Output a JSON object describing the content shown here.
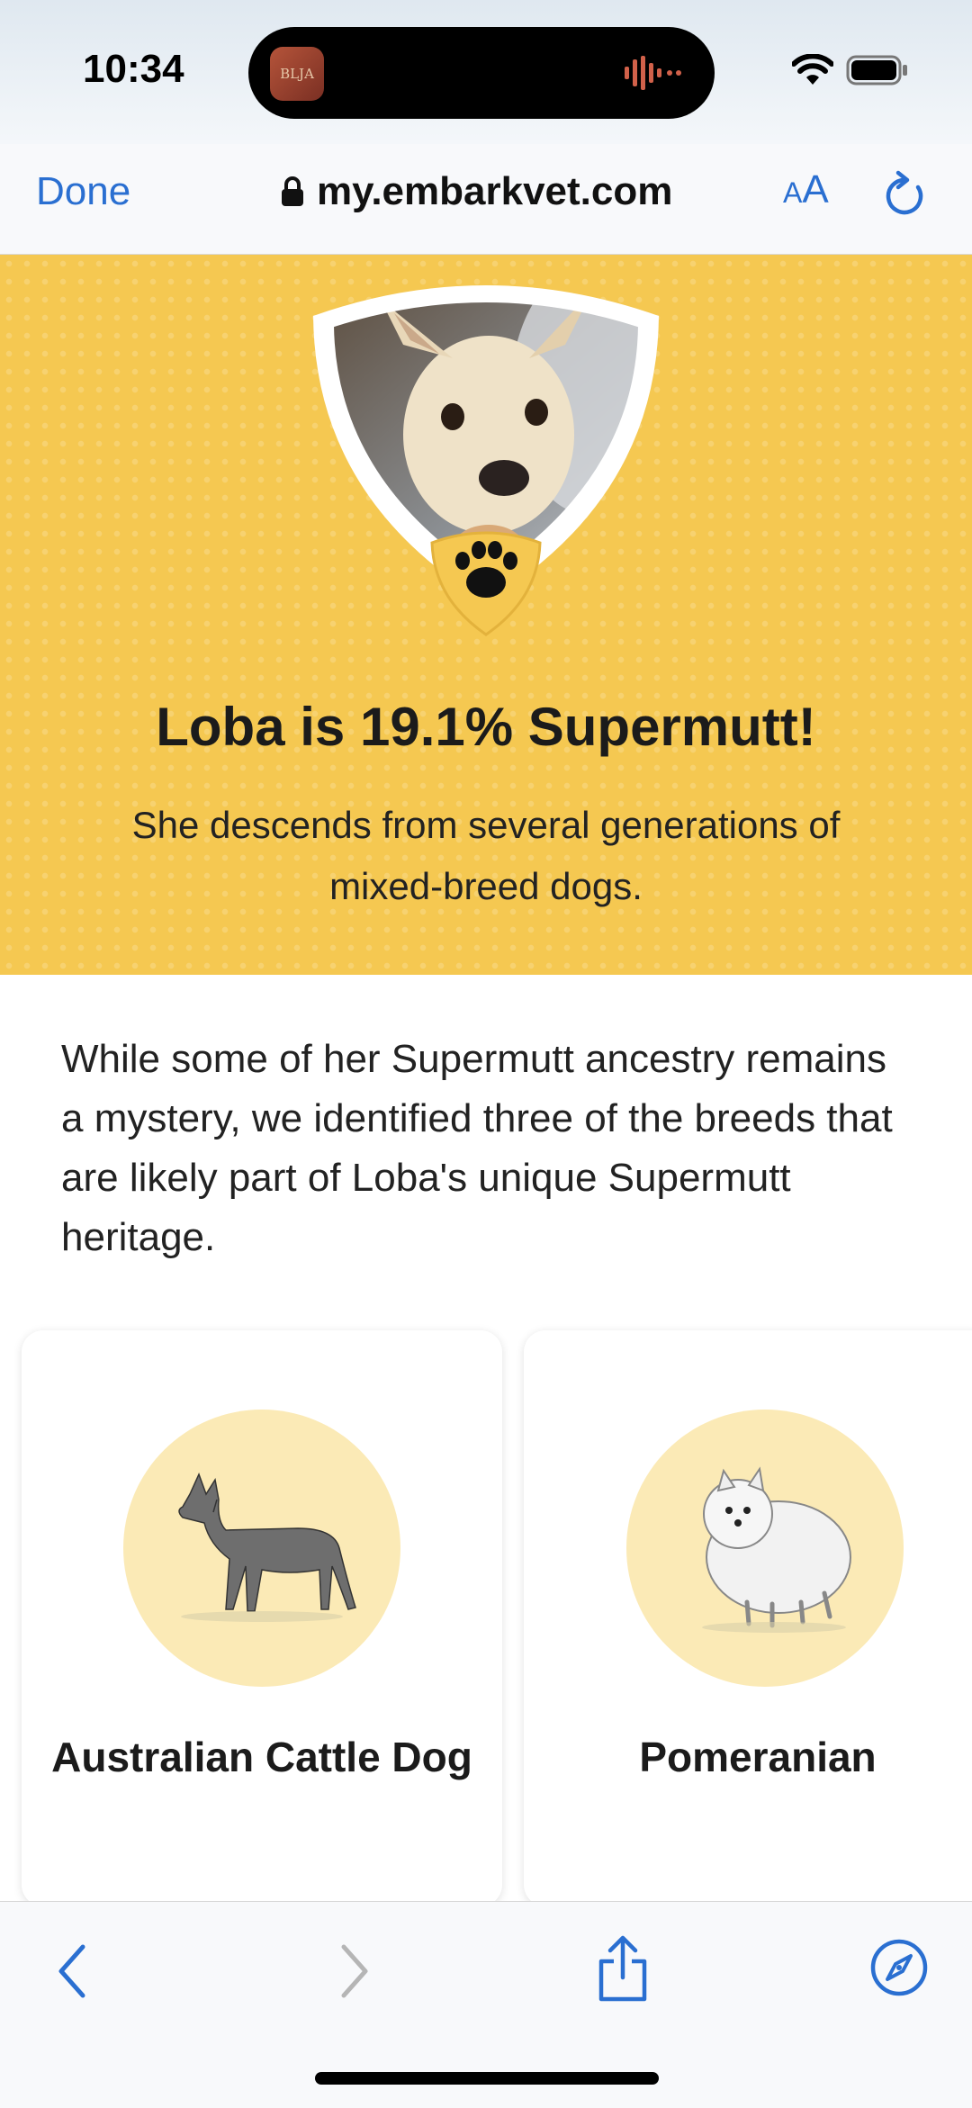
{
  "status": {
    "time": "10:34",
    "island_app_text": "BLJA"
  },
  "browser": {
    "done_label": "Done",
    "url": "my.embarkvet.com",
    "text_size_small": "A",
    "text_size_large": "A"
  },
  "hero": {
    "title": "Loba is 19.1% Supermutt!",
    "subtitle": "She descends from several generations of mixed-breed dogs."
  },
  "intro": "While some of her Supermutt ancestry remains a mystery, we identified three of the breeds that are likely part of Loba's unique Supermutt heritage.",
  "breeds": [
    {
      "name": "Australian Cattle Dog"
    },
    {
      "name": "Pomeranian"
    }
  ],
  "colors": {
    "accent": "#2a6fd1",
    "hero_yellow": "#f5c851",
    "circle_yellow": "#fbeab6"
  }
}
